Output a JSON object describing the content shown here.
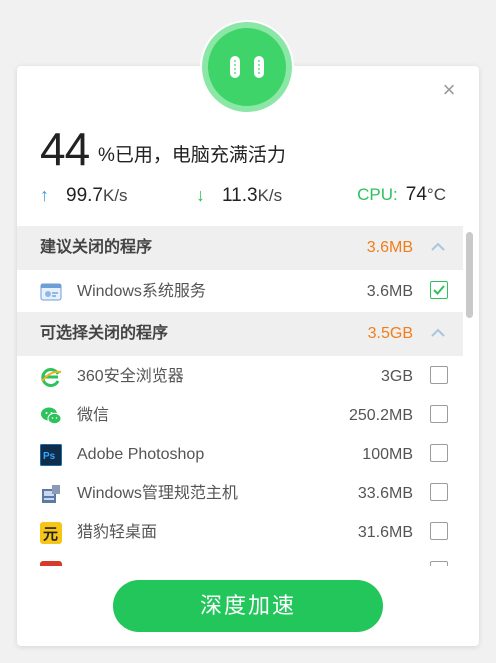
{
  "close_icon": "close-icon",
  "usage": {
    "percent": "44",
    "label": "%已用，电脑充满活力"
  },
  "speeds": {
    "up": {
      "value": "99.7",
      "unit": "K/s"
    },
    "down": {
      "value": "11.3",
      "unit": "K/s"
    },
    "cpu": {
      "label": "CPU:",
      "value": "74",
      "unit": "°C"
    }
  },
  "sections": [
    {
      "title": "建议关闭的程序",
      "size": "3.6MB",
      "items": [
        {
          "name": "Windows系统服务",
          "size": "3.6MB",
          "checked": true,
          "icon": "windows-service-icon"
        }
      ]
    },
    {
      "title": "可选择关闭的程序",
      "size": "3.5GB",
      "items": [
        {
          "name": "360安全浏览器",
          "size": "3GB",
          "checked": false,
          "icon": "360-browser-icon"
        },
        {
          "name": "微信",
          "size": "250.2MB",
          "checked": false,
          "icon": "wechat-icon"
        },
        {
          "name": "Adobe Photoshop",
          "size": "100MB",
          "checked": false,
          "icon": "photoshop-icon"
        },
        {
          "name": "Windows管理规范主机",
          "size": "33.6MB",
          "checked": false,
          "icon": "windows-management-icon"
        },
        {
          "name": "猎豹轻桌面",
          "size": "31.6MB",
          "checked": false,
          "icon": "cheetah-desktop-icon"
        }
      ]
    }
  ],
  "button": {
    "label": "深度加速"
  },
  "colors": {
    "accent": "#23c65a",
    "orange": "#f07f1a",
    "blue": "#3b9de8"
  }
}
